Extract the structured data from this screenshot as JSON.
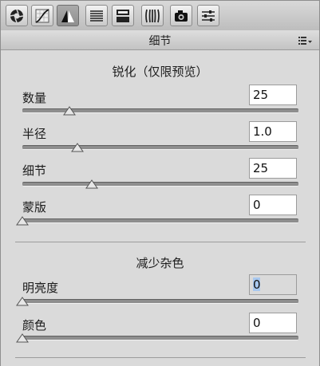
{
  "toolbar": {
    "tools": [
      {
        "icon": "aperture-icon"
      },
      {
        "icon": "tone-curve-icon"
      },
      {
        "icon": "detail-triangle-icon",
        "active": true
      },
      {
        "icon": "hsl-lines-icon"
      },
      {
        "icon": "split-toning-icon"
      },
      {
        "icon": "lens-corrections-icon"
      },
      {
        "icon": "camera-icon"
      },
      {
        "icon": "presets-sliders-icon"
      }
    ]
  },
  "panel": {
    "title": "细节",
    "sharpening": {
      "title": "锐化（仅限预览）",
      "amount": {
        "label": "数量",
        "value": "25",
        "level": 0.17
      },
      "radius": {
        "label": "半径",
        "value": "1.0",
        "level": 0.2
      },
      "detail": {
        "label": "细节",
        "value": "25",
        "level": 0.25
      },
      "masking": {
        "label": "蒙版",
        "value": "0",
        "level": 0.0
      }
    },
    "noise": {
      "title": "减少杂色",
      "luminance": {
        "label": "明亮度",
        "value": "0",
        "level": 0.0
      },
      "color": {
        "label": "颜色",
        "value": "0",
        "level": 0.0
      }
    }
  }
}
